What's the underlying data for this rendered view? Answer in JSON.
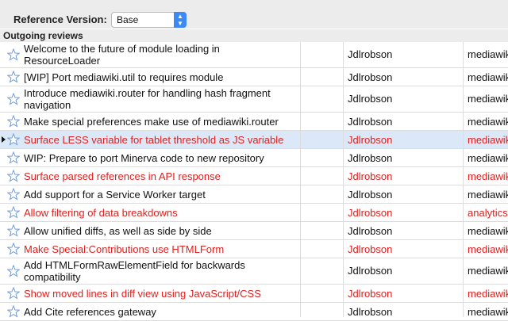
{
  "toolbar": {
    "reference_label": "Reference Version:",
    "reference_value": "Base"
  },
  "section_title": "Outgoing reviews",
  "colors": {
    "highlight_text": "#e0201e",
    "selected_row": "#dbe8f7",
    "select_arrow": "#3d8af7"
  },
  "reviews": [
    {
      "title": "Welcome to the future of module loading in ResourceLoader",
      "owner": "Jdlrobson",
      "project": "mediawiki",
      "red": false,
      "selected": false,
      "lines": 2
    },
    {
      "title": "[WIP] Port mediawiki.util to requires module",
      "owner": "Jdlrobson",
      "project": "mediawiki",
      "red": false,
      "selected": false,
      "lines": 1
    },
    {
      "title": "Introduce mediawiki.router for handling hash fragment navigation",
      "owner": "Jdlrobson",
      "project": "mediawiki",
      "red": false,
      "selected": false,
      "lines": 2
    },
    {
      "title": "Make special preferences make use of mediawiki.router",
      "owner": "Jdlrobson",
      "project": "mediawiki",
      "red": false,
      "selected": false,
      "lines": 1
    },
    {
      "title": "Surface LESS variable for tablet threshold as JS variable",
      "owner": "Jdlrobson",
      "project": "mediawiki",
      "red": true,
      "selected": true,
      "lines": 1
    },
    {
      "title": "WIP: Prepare to port Minerva code to new repository",
      "owner": "Jdlrobson",
      "project": "mediawiki",
      "red": false,
      "selected": false,
      "lines": 1
    },
    {
      "title": "Surface parsed references in API response",
      "owner": "Jdlrobson",
      "project": "mediawiki",
      "red": true,
      "selected": false,
      "lines": 1
    },
    {
      "title": "Add support for a Service Worker target",
      "owner": "Jdlrobson",
      "project": "mediawiki",
      "red": false,
      "selected": false,
      "lines": 1
    },
    {
      "title": "Allow filtering of data breakdowns",
      "owner": "Jdlrobson",
      "project": "analytics",
      "red": true,
      "selected": false,
      "lines": 1
    },
    {
      "title": "Allow unified diffs, as well as side by side",
      "owner": "Jdlrobson",
      "project": "mediawiki",
      "red": false,
      "selected": false,
      "lines": 1
    },
    {
      "title": "Make Special:Contributions use HTMLForm",
      "owner": "Jdlrobson",
      "project": "mediawiki",
      "red": true,
      "selected": false,
      "lines": 1
    },
    {
      "title": "Add HTMLFormRawElementField for backwards compatibility",
      "owner": "Jdlrobson",
      "project": "mediawiki",
      "red": false,
      "selected": false,
      "lines": 2
    },
    {
      "title": "Show moved lines in diff view using JavaScript/CSS",
      "owner": "Jdlrobson",
      "project": "mediawiki",
      "red": true,
      "selected": false,
      "lines": 1
    },
    {
      "title": "Add Cite references gateway",
      "owner": "Jdlrobson",
      "project": "mediawiki",
      "red": false,
      "selected": false,
      "lines": 1
    }
  ]
}
